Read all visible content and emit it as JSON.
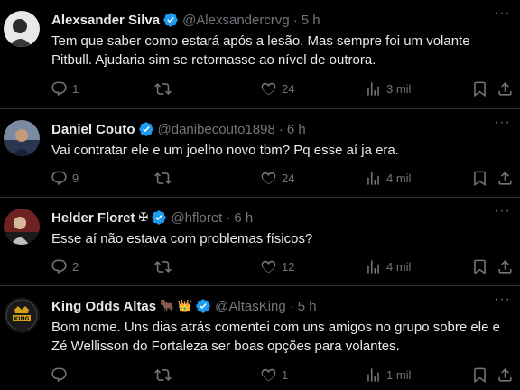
{
  "tweets": [
    {
      "name": "Alexsander Silva",
      "handle": "@Alexsandercrvg",
      "time": "5 h",
      "text": "Tem que saber como estará após a lesão. Mas sempre foi um volante Pitbull. Ajudaria sim se retornasse ao nível de outrora.",
      "replies": "1",
      "retweets": "",
      "likes": "24",
      "views": "3 mil",
      "avatar_color": "#d9d9d9"
    },
    {
      "name": "Daniel Couto",
      "handle": "@danibecouto1898",
      "time": "6 h",
      "text": "Vai contratar ele e um joelho novo tbm?  Pq esse aí ja era.",
      "replies": "9",
      "retweets": "",
      "likes": "24",
      "views": "4 mil",
      "avatar_color": "#3a4a6a"
    },
    {
      "name": "Helder Floret",
      "name_emoji": "✠",
      "handle": "@hfloret",
      "time": "6 h",
      "text": "Esse aí não estava com problemas físicos?",
      "replies": "2",
      "retweets": "",
      "likes": "12",
      "views": "4 mil",
      "avatar_color": "#5a1f1f"
    },
    {
      "name": "King Odds Altas",
      "name_emoji": "🐂 👑",
      "handle": "@AltasKing",
      "time": "5 h",
      "text": "Bom nome. Uns dias atrás comentei com uns amigos no grupo sobre ele e Zé Wellisson do Fortaleza ser boas opções para volantes.",
      "replies": "",
      "retweets": "",
      "likes": "1",
      "views": "1 mil",
      "avatar_color": "#1a1a1a"
    }
  ],
  "colors": {
    "background": "#000000",
    "text": "#e7e9ea",
    "muted": "#71767b",
    "verified": "#1d9bf0",
    "divider": "#2f3336"
  }
}
